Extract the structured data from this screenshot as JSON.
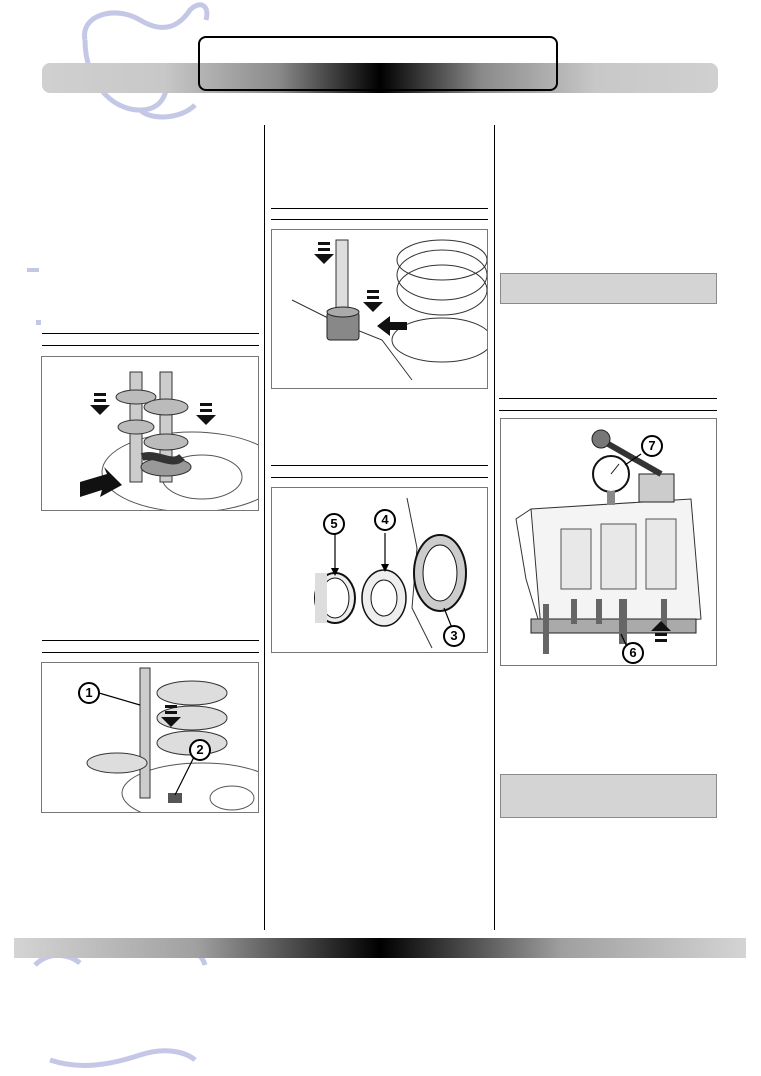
{
  "page": {
    "header_title": "",
    "watermark": "watermark-logo"
  },
  "figures": {
    "fig1": {
      "callouts": []
    },
    "fig2": {
      "callouts": [
        "1",
        "2"
      ]
    },
    "fig3": {
      "callouts": []
    },
    "fig4": {
      "callouts": [
        "5",
        "4",
        "3"
      ]
    },
    "fig5": {
      "callouts": [
        "7",
        "6"
      ]
    }
  },
  "notes": {
    "note1": "",
    "note2": ""
  }
}
